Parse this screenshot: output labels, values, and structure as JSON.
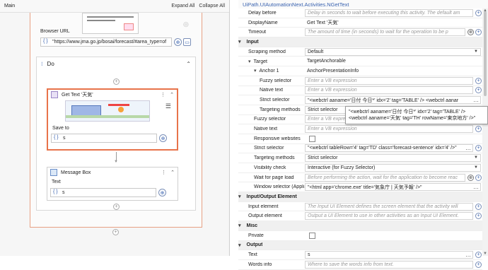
{
  "designer": {
    "header_title": "Main",
    "expand_all": "Expand All",
    "collapse_all": "Collapse All",
    "browser_url_label": "Browser URL",
    "browser_url_value": "\"https://www.jma.go.jp/bosai/forecast/#area_type=of",
    "do_label": "Do",
    "get_text": {
      "title": "Get Text '天気'",
      "save_to_label": "Save to",
      "save_to_value": "s"
    },
    "message_box": {
      "title": "Message Box",
      "text_label": "Text",
      "text_value": "s"
    }
  },
  "props": {
    "title": "UiPath.UIAutomationNext.Activities.NGetText",
    "rows": [
      {
        "name": "Delay before",
        "value": "Delay in seconds to wait before executing this activity. The default am",
        "kind": "ph",
        "indent": 0
      },
      {
        "name": "DisplayName",
        "value": "Get Text '天気'",
        "kind": "plain",
        "indent": 0
      },
      {
        "name": "Timeout",
        "value": "The amount of time (in seconds) to wait for the operation to be p",
        "kind": "ph-btns",
        "indent": 0
      },
      {
        "name": "Input",
        "kind": "cat"
      },
      {
        "name": "Scraping method",
        "value": "Default",
        "kind": "select",
        "indent": 0
      },
      {
        "name": "Target",
        "value": "TargetAnchorable",
        "kind": "exp",
        "indent": 0
      },
      {
        "name": "Anchor 1",
        "value": "AnchorPresentationInfo",
        "kind": "exp",
        "indent": 1
      },
      {
        "name": "Fuzzy selector",
        "value": "Enter a VB expression",
        "kind": "ph",
        "indent": 2
      },
      {
        "name": "Native text",
        "value": "Enter a VB expression",
        "kind": "ph",
        "indent": 2
      },
      {
        "name": "Strict selector",
        "value": "\"<webctrl aaname='日付 今日*' idx='2' tag='TABLE' /> <webctrl aanar",
        "kind": "text",
        "indent": 2
      },
      {
        "name": "Targeting methods",
        "value": "Strict selector",
        "kind": "select",
        "indent": 2
      },
      {
        "name": "Fuzzy selector",
        "value": "Enter a VB expression",
        "kind": "ph",
        "indent": 1
      },
      {
        "name": "Native text",
        "value": "Enter a VB expression",
        "kind": "ph",
        "indent": 1
      },
      {
        "name": "Responsive websites",
        "value": "",
        "kind": "check",
        "indent": 1
      },
      {
        "name": "Strict selector",
        "value": "\"<webctrl tableRow='4' tag='TD' class='forecast-sentence' idx='4' />\"",
        "kind": "text-dots",
        "indent": 1
      },
      {
        "name": "Targeting methods",
        "value": "Strict selector",
        "kind": "select",
        "indent": 1
      },
      {
        "name": "Visibility check",
        "value": "Interactive (for Fuzzy Selector)",
        "kind": "select",
        "indent": 1
      },
      {
        "name": "Wait for page load",
        "value": "Before performing the action, wait for the application to become reac",
        "kind": "ph-btns",
        "indent": 1
      },
      {
        "name": "Window selector (Appli...",
        "value": "\"<html app='chrome.exe' title='気象庁 | 天気予報' />\"",
        "kind": "text",
        "indent": 1
      },
      {
        "name": "Input/Output Element",
        "kind": "cat"
      },
      {
        "name": "Input element",
        "value": "The Input UI Element defines the screen element that the activity will",
        "kind": "ph",
        "indent": 0
      },
      {
        "name": "Output element",
        "value": "Output a UI Element to use in other activities as an Input UI Element.",
        "kind": "ph",
        "indent": 0
      },
      {
        "name": "Misc",
        "kind": "cat"
      },
      {
        "name": "Private",
        "value": "",
        "kind": "check",
        "indent": 0
      },
      {
        "name": "Output",
        "kind": "cat"
      },
      {
        "name": "Text",
        "value": "s",
        "kind": "text-dots",
        "indent": 0
      },
      {
        "name": "Words info",
        "value": "Where to save the words info from text.",
        "kind": "ph",
        "indent": 0
      }
    ],
    "tooltip": "\"<webctrl aaname='日付 今日*' idx='2' tag='TABLE' /> <webctrl aaname='天気' tag='TH' rowName='東京地方' />\""
  }
}
